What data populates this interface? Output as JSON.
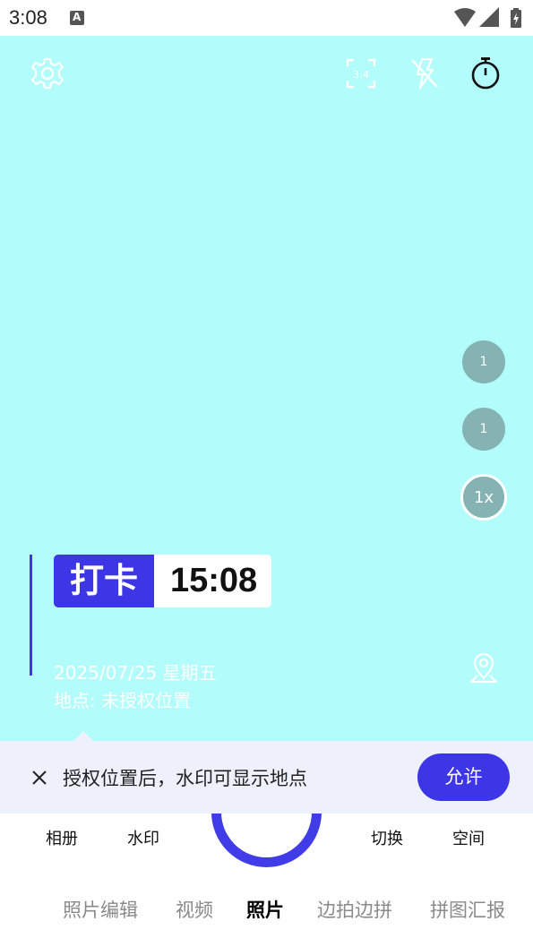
{
  "status_bar": {
    "time": "3:08"
  },
  "camera": {
    "icons": [
      "gear-icon",
      "aspect-ratio-icon",
      "flash-off-icon",
      "timer-icon"
    ],
    "aspect_label": "3:4",
    "zoom_levels": [
      "1",
      "1",
      "1x"
    ],
    "bg_color": "#b3fcfc"
  },
  "watermark": {
    "tag": "打卡",
    "time": "15:08",
    "date": "2025/07/25 星期五",
    "location": "地点: 未授权位置",
    "accent_color": "#3d36e6"
  },
  "banner": {
    "text": "授权位置后，水印可显示地点",
    "allow_label": "允许"
  },
  "controls": {
    "album": "相册",
    "watermark": "水印",
    "switch": "切换",
    "space": "空间"
  },
  "modes": [
    "照片编辑",
    "视频",
    "照片",
    "边拍边拼",
    "拼图汇报"
  ],
  "active_mode": "照片"
}
